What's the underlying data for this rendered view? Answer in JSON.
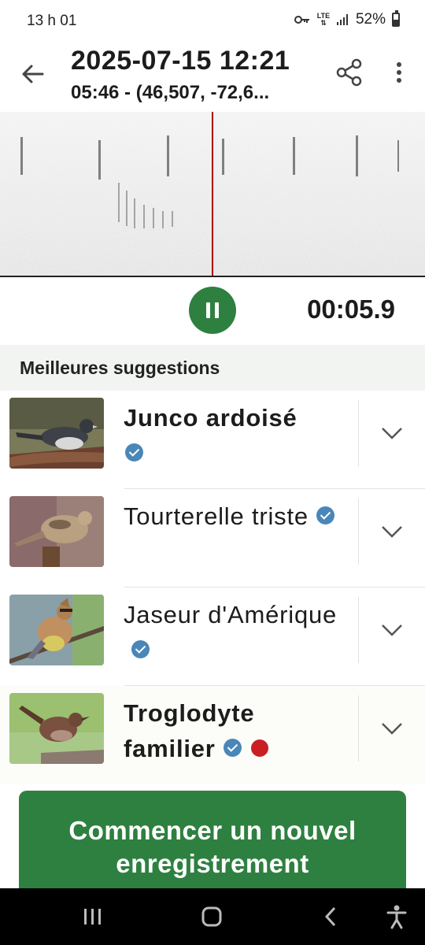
{
  "status_bar": {
    "time": "13 h 01",
    "network": "LTE",
    "battery": "52%",
    "battery_level": 0.52
  },
  "header": {
    "title": "2025-07-15 12:21",
    "subtitle": "05:46 - (46,507, -72,6..."
  },
  "playback": {
    "elapsed": "00:05.9"
  },
  "suggestions": {
    "title": "Meilleures suggestions",
    "items": [
      {
        "name": "Junco ardoisé",
        "bold": true,
        "verified": true,
        "flagged": false
      },
      {
        "name": "Tourterelle triste",
        "bold": false,
        "verified": true,
        "flagged": false
      },
      {
        "name": "Jaseur d'Amérique",
        "bold": false,
        "verified": true,
        "flagged": false
      },
      {
        "name": "Troglodyte familier",
        "bold": true,
        "verified": true,
        "flagged": true
      }
    ]
  },
  "cta": {
    "label": "Commencer un nouvel enregistrement"
  },
  "colors": {
    "accent": "#2e8040",
    "badge": "#4a86b8",
    "flag": "#c81e24",
    "playhead": "#b00000"
  },
  "icons": [
    "back-arrow-icon",
    "share-icon",
    "more-vert-icon",
    "pause-icon",
    "chevron-down-icon",
    "recent-apps-icon",
    "home-icon",
    "nav-back-icon",
    "accessibility-icon"
  ]
}
